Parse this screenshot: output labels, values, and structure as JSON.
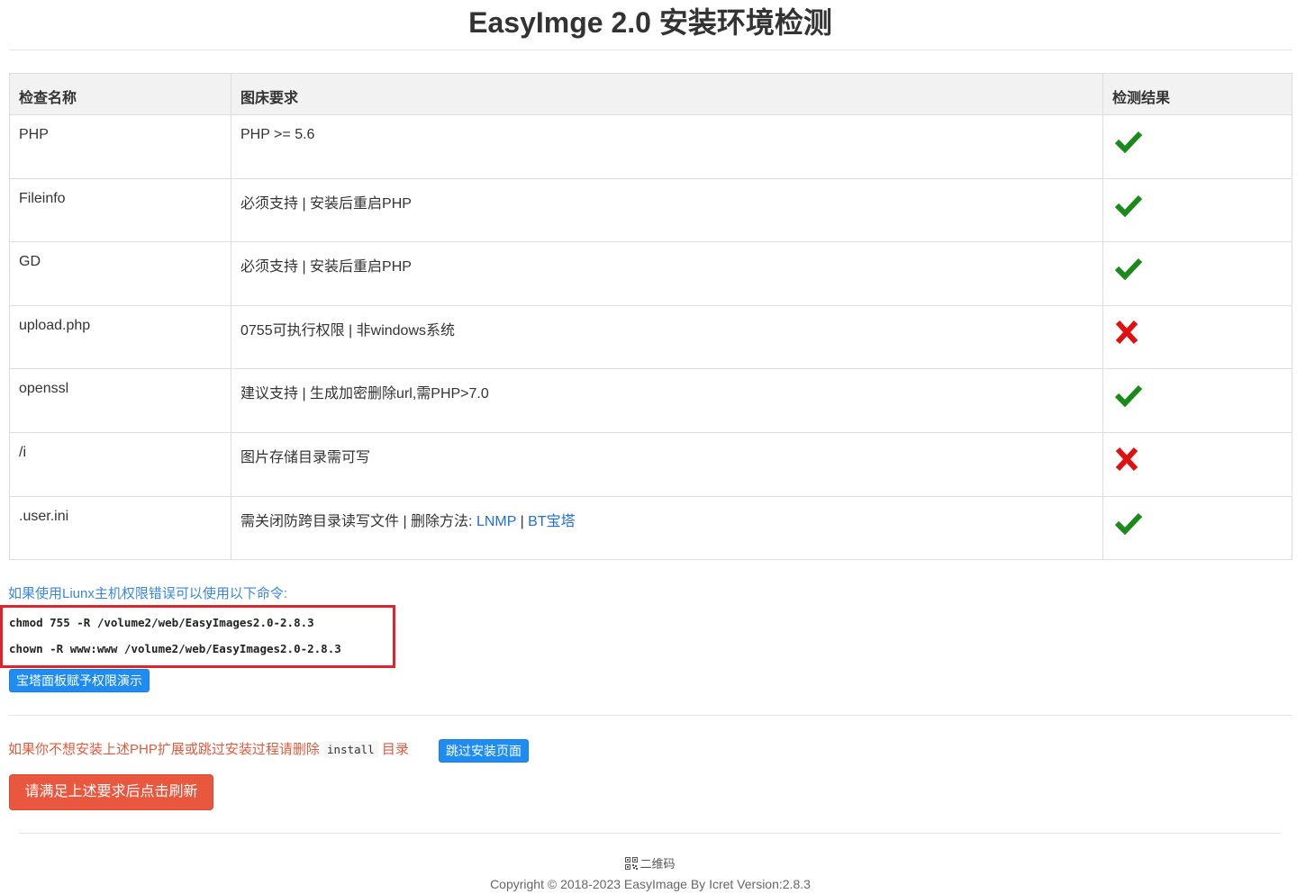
{
  "page": {
    "title": "EasyImge 2.0 安装环境检测"
  },
  "table": {
    "headers": [
      "检查名称",
      "图床要求",
      "检测结果"
    ],
    "rows": [
      {
        "name": "PHP",
        "requirement": "PHP >= 5.6",
        "result": "pass"
      },
      {
        "name": "Fileinfo",
        "requirement": "必须支持 | 安装后重启PHP",
        "result": "pass"
      },
      {
        "name": "GD",
        "requirement": "必须支持 | 安装后重启PHP",
        "result": "pass"
      },
      {
        "name": "upload.php",
        "requirement": "0755可执行权限 | 非windows系统",
        "result": "fail"
      },
      {
        "name": "openssl",
        "requirement": "建议支持 | 生成加密删除url,需PHP>7.0",
        "result": "pass"
      },
      {
        "name": "/i",
        "requirement": "图片存储目录需可写",
        "result": "fail"
      },
      {
        "name": ".user.ini",
        "requirement": "需关闭防跨目录读写文件 | 删除方法: ",
        "result": "pass",
        "links": [
          "LNMP",
          "BT宝塔"
        ],
        "link_separator": " | "
      }
    ],
    "pass_icon": "checkmark-icon",
    "fail_icon": "cross-icon",
    "pass_color": "#1a8a1a",
    "fail_color": "#e01010"
  },
  "linux_note": {
    "text": "如果使用Liunx主机权限错误可以使用以下命令:",
    "commands": [
      "chmod 755 -R /volume2/web/EasyImages2.0-2.8.3",
      "chown -R www:www /volume2/web/EasyImages2.0-2.8.3"
    ],
    "demo_button": "宝塔面板赋予权限演示"
  },
  "skip_note": {
    "text_before": "如果你不想安装上述PHP扩展或跳过安装过程请删除",
    "code": "install",
    "text_after": "目录",
    "skip_button": "跳过安装页面"
  },
  "refresh_button": "请满足上述要求后点击刷新",
  "footer": {
    "qr_label": "二维码",
    "copyright": "Copyright © 2018-2023 EasyImage By Icret Version:2.8.3"
  },
  "colors": {
    "accent_blue": "#1e8cf0",
    "note_blue": "#3a87e0",
    "note_red": "#e05a3d",
    "refresh_button": "#e9573f",
    "highlight_box": "#e0242e"
  }
}
